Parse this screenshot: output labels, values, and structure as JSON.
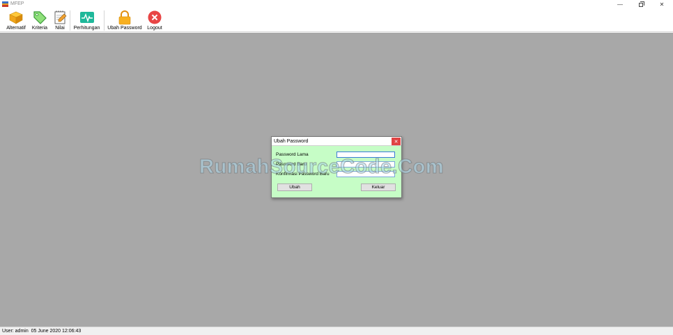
{
  "window": {
    "title": "MFEP",
    "minimize_glyph": "—",
    "close_glyph": "✕"
  },
  "toolbar": {
    "items": [
      {
        "label": "Alternatif",
        "icon": "cube-icon"
      },
      {
        "label": "Kriteria",
        "icon": "tag-icon"
      },
      {
        "label": "Nilai",
        "icon": "notepad-icon"
      },
      {
        "label": "Perhitungan",
        "icon": "pulse-icon"
      },
      {
        "label": "Ubah Password",
        "icon": "lock-icon"
      },
      {
        "label": "Logout",
        "icon": "close-circle-icon"
      }
    ]
  },
  "dialog": {
    "title": "Ubah Password",
    "close_glyph": "✕",
    "fields": [
      {
        "label": "Password Lama",
        "value": ""
      },
      {
        "label": "Password Baru",
        "value": ""
      },
      {
        "label": "Konfirmasi Password Baru",
        "value": ""
      }
    ],
    "ubah_label": "Ubah",
    "keluar_label": "Keluar",
    "background": "#c6fdc6"
  },
  "watermark": "RumahSourceCode.Com",
  "status": {
    "text": "User: admin  05 June 2020 12:06:43"
  },
  "colors": {
    "mdi_background": "#a8a8a8",
    "close_red": "#e04343"
  }
}
